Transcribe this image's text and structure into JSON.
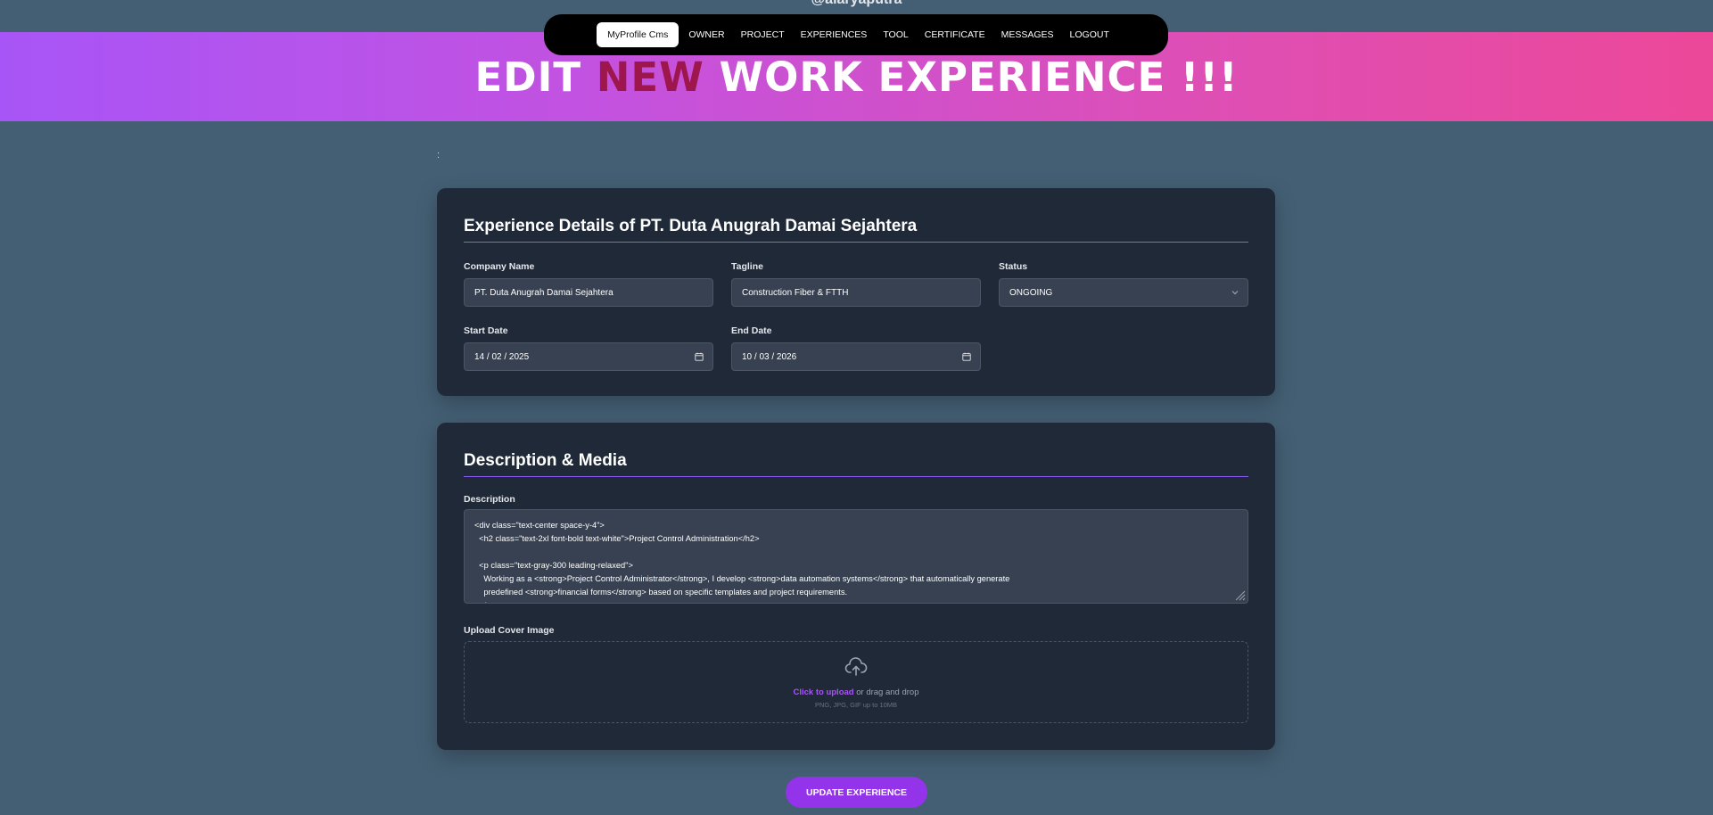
{
  "header": {
    "handle": "@aiaryaputra",
    "title_part1": "EDIT",
    "title_accent": "NEW",
    "title_part2": "WORK EXPERIENCE !!!"
  },
  "nav": {
    "items": [
      {
        "label": "MyProfile Cms",
        "active": true
      },
      {
        "label": "OWNER"
      },
      {
        "label": "PROJECT"
      },
      {
        "label": "EXPERIENCES"
      },
      {
        "label": "TOOL"
      },
      {
        "label": "CERTIFICATE"
      },
      {
        "label": "MESSAGES"
      },
      {
        "label": "LOGOUT"
      }
    ]
  },
  "colon_mark": ":",
  "details": {
    "section_title": "Experience Details of PT. Duta Anugrah Damai Sejahtera",
    "company_name": {
      "label": "Company Name",
      "value": "PT. Duta Anugrah Damai Sejahtera"
    },
    "tagline": {
      "label": "Tagline",
      "value": "Construction Fiber & FTTH"
    },
    "status": {
      "label": "Status",
      "value": "ONGOING"
    },
    "start_date": {
      "label": "Start Date",
      "value": "14 / 02 / 2025"
    },
    "end_date": {
      "label": "End Date",
      "value": "10 / 03 / 2026"
    }
  },
  "media": {
    "section_title": "Description & Media",
    "description_label": "Description",
    "description_value": "<div class=\"text-center space-y-4\">\n  <h2 class=\"text-2xl font-bold text-white\">Project Control Administration</h2>\n\n  <p class=\"text-gray-300 leading-relaxed\">\n    Working as a <strong>Project Control Administrator</strong>, I develop <strong>data automation systems</strong> that automatically generate\n    predefined <strong>financial forms</strong> based on specific templates and project requirements.\n  </p>",
    "upload_label": "Upload Cover Image",
    "upload_link": "Click to upload",
    "upload_rest": " or drag and drop",
    "upload_hint": "PNG, JPG, GIF up to 10MB"
  },
  "submit_label": "UPDATE EXPERIENCE",
  "colors": {
    "page_bg": "#445f74",
    "card_bg": "#1f2937",
    "accent": "#9333ea",
    "title_accent": "#9d174d"
  }
}
